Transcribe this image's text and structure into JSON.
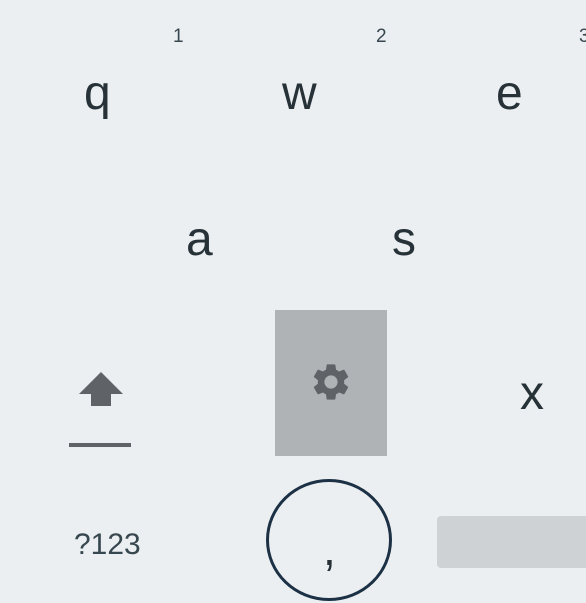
{
  "keyboard": {
    "rows": [
      {
        "keys": [
          {
            "char": "q",
            "hint": "1"
          },
          {
            "char": "w",
            "hint": "2"
          },
          {
            "char": "e",
            "hint": "3"
          }
        ]
      },
      {
        "keys": [
          {
            "char": "a"
          },
          {
            "char": "s"
          }
        ]
      },
      {
        "keys": [
          {
            "icon": "shift-icon"
          },
          {
            "icon": "gear-icon",
            "state": "pressed"
          },
          {
            "char": "x"
          }
        ]
      },
      {
        "keys": [
          {
            "label": "?123"
          },
          {
            "char": ","
          },
          {
            "icon": "spacebar"
          }
        ]
      }
    ],
    "colors": {
      "background": "#eceff1",
      "key_text": "#263238",
      "pressed_key": "#b0b3b6",
      "icon": "#5f6368",
      "highlight_ring": "#1c3145",
      "spacebar": "#cfd2d5"
    }
  }
}
